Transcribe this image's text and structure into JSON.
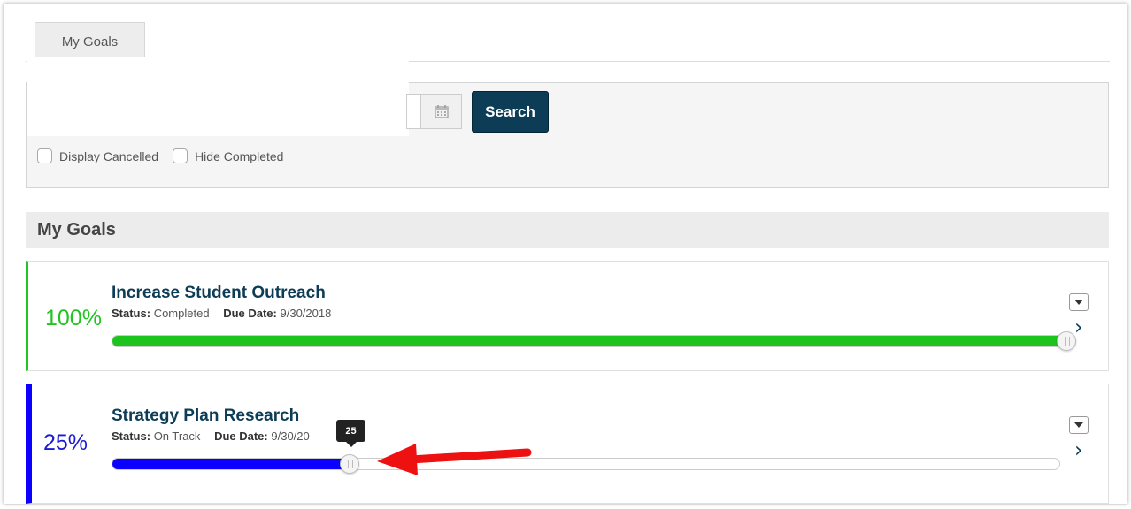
{
  "tabs": {
    "my_goals": "My Goals"
  },
  "search": {
    "button_label": "Search",
    "calendar_icon": "calendar-icon"
  },
  "filters": {
    "display_cancelled": "Display Cancelled",
    "hide_completed": "Hide Completed"
  },
  "section": {
    "title": "My Goals"
  },
  "goals": [
    {
      "percent_label": "100%",
      "progress": 100,
      "title": "Increase Student Outreach",
      "status_label": "Status:",
      "status": "Completed",
      "due_label": "Due Date:",
      "due_date": "9/30/2018",
      "color": "#22c422"
    },
    {
      "percent_label": "25%",
      "progress": 25,
      "title": "Strategy Plan Research",
      "status_label": "Status:",
      "status": "On Track",
      "due_label": "Due Date:",
      "due_date": "9/30/20",
      "tooltip_value": "25",
      "color": "#0b00ff"
    }
  ],
  "annotation": {
    "arrow_color": "#ee1111"
  }
}
